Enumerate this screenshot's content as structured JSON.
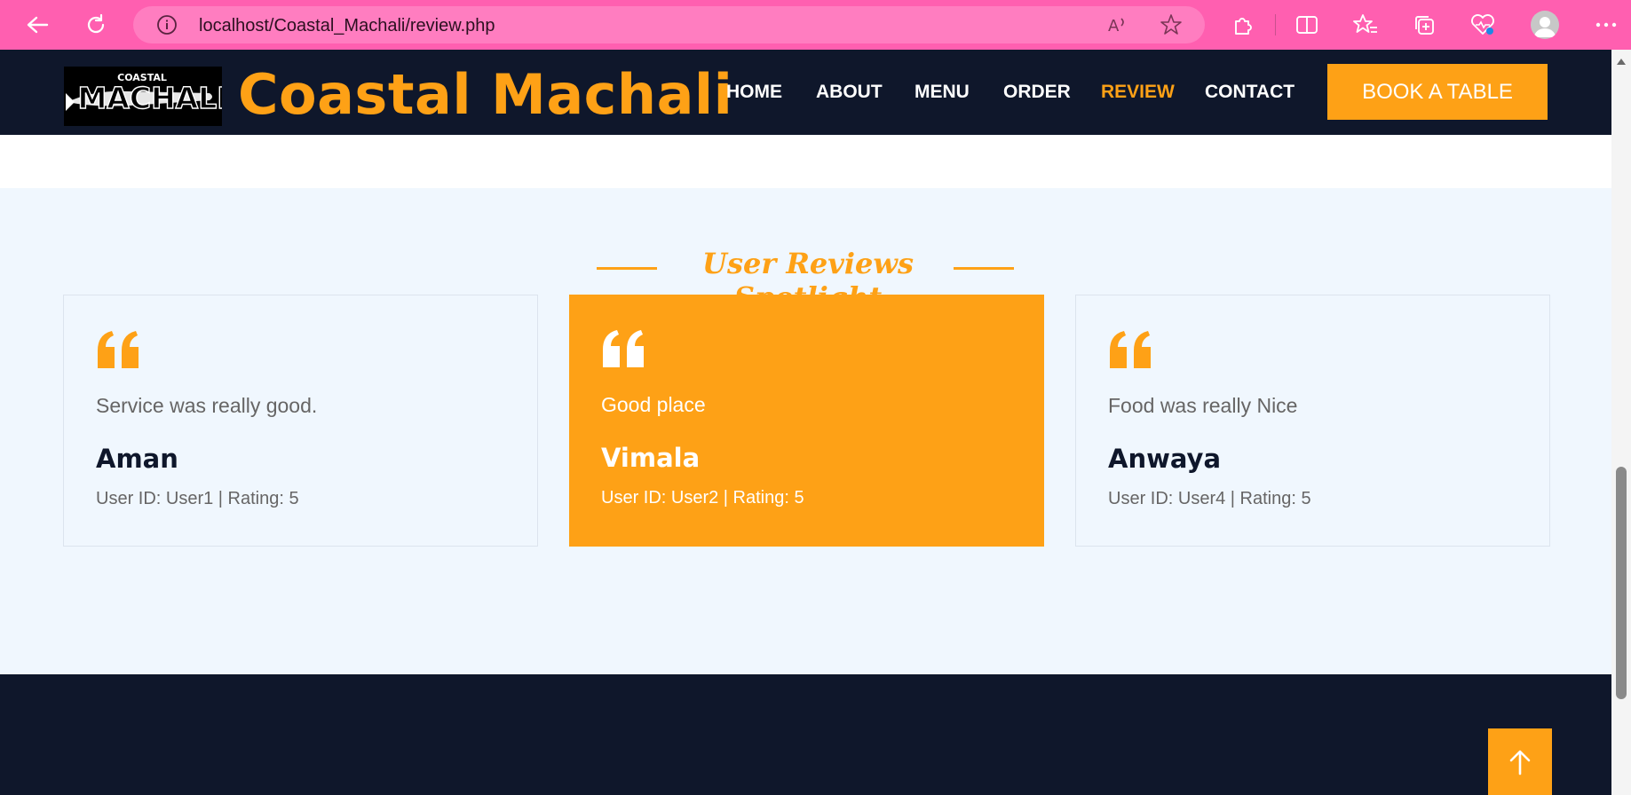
{
  "browser": {
    "url": "localhost/Coastal_Machali/review.php",
    "icons": [
      "back-arrow-icon",
      "refresh-icon",
      "info-icon",
      "read-aloud-icon",
      "favorite-star-icon",
      "extensions-icon",
      "split-screen-icon",
      "favorites-icon",
      "collections-icon",
      "browser-essentials-icon",
      "profile-avatar-icon",
      "more-menu-icon"
    ]
  },
  "header": {
    "brand": "Coastal Machali",
    "logo_text": "MACHALI",
    "logo_subtext": "COASTAL",
    "nav": [
      {
        "label": "HOME",
        "active": false
      },
      {
        "label": "ABOUT",
        "active": false
      },
      {
        "label": "MENU",
        "active": false
      },
      {
        "label": "ORDER",
        "active": false
      },
      {
        "label": "REVIEW",
        "active": true
      },
      {
        "label": "CONTACT",
        "active": false
      }
    ],
    "cta": "BOOK A TABLE"
  },
  "reviews_section": {
    "title": "User Reviews Spotlight",
    "reviews": [
      {
        "text": "Service was really good.",
        "name": "Aman",
        "meta": "User ID: User1 | Rating: 5",
        "highlighted": false
      },
      {
        "text": "Good place",
        "name": "Vimala",
        "meta": "User ID: User2 | Rating: 5",
        "highlighted": true
      },
      {
        "text": "Food was really Nice",
        "name": "Anwaya",
        "meta": "User ID: User4 | Rating: 5",
        "highlighted": false
      }
    ]
  },
  "colors": {
    "accent": "#fea116",
    "dark": "#0f172b",
    "section_bg": "#f0f7fe",
    "browser_bar": "#ff5fb0"
  },
  "back_to_top_icon": "arrow-up-icon"
}
